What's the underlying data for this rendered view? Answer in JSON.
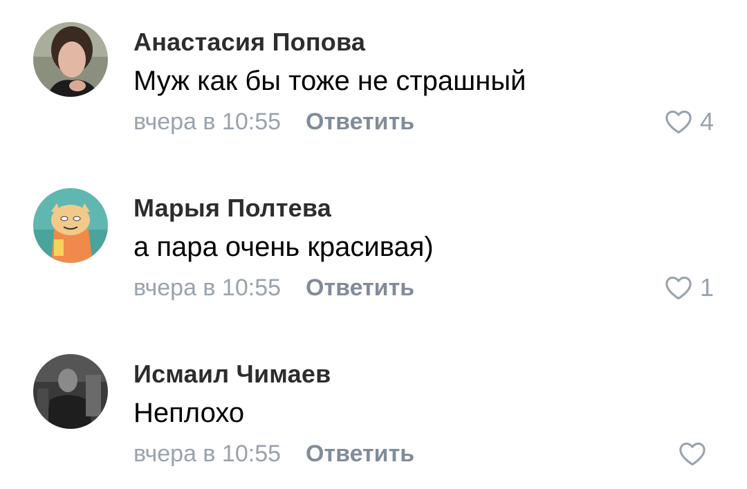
{
  "comments": [
    {
      "author": "Анастасия Попова",
      "text": "Муж как бы тоже не страшный",
      "time": "вчера в 10:55",
      "reply_label": "Ответить",
      "likes": "4",
      "avatar_icon": "user-photo-avatar"
    },
    {
      "author": "Марыя Полтева",
      "text": "а пара очень красивая)",
      "time": "вчера в 10:55",
      "reply_label": "Ответить",
      "likes": "1",
      "avatar_icon": "cartoon-character-avatar"
    },
    {
      "author": "Исмаил Чимаев",
      "text": "Неплохо",
      "time": "вчера в 10:55",
      "reply_label": "Ответить",
      "likes": "",
      "avatar_icon": "dark-photo-avatar"
    }
  ],
  "colors": {
    "author": "#2c2d2e",
    "secondary": "#99a2ad",
    "reply": "#818c99",
    "text": "#000000"
  },
  "icons": {
    "like": "heart-outline-icon"
  }
}
